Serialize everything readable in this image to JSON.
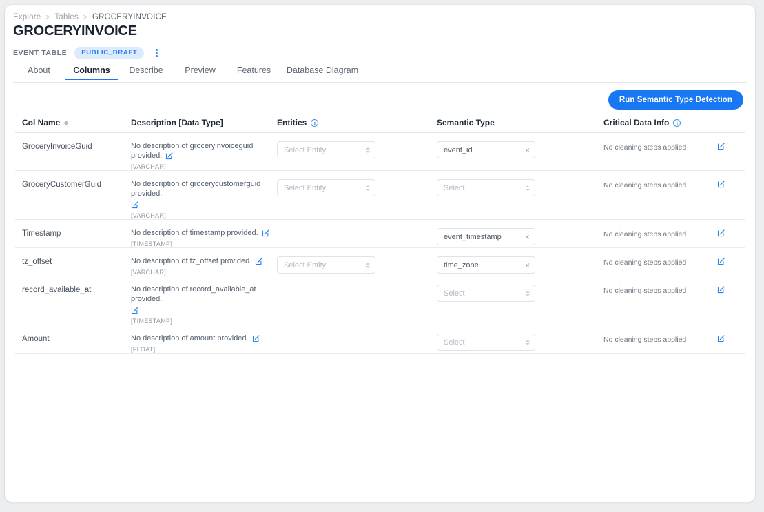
{
  "breadcrumb": {
    "items": [
      "Explore",
      "Tables",
      "GROCERYINVOICE"
    ],
    "separator": ">"
  },
  "header": {
    "title": "GROCERYINVOICE",
    "kind": "EVENT TABLE",
    "badge": "PUBLIC_DRAFT",
    "kebab_icon": "more-vertical-icon"
  },
  "tabs": [
    {
      "label": "About",
      "active": false,
      "width": 75
    },
    {
      "label": "Columns",
      "active": true,
      "width": 78
    },
    {
      "label": "Describe",
      "active": false,
      "width": 80
    },
    {
      "label": "Preview",
      "active": false,
      "width": 77
    },
    {
      "label": "Features",
      "active": false,
      "width": 79
    },
    {
      "label": "Database Diagram",
      "active": false,
      "width": 120
    }
  ],
  "toolbar": {
    "run_detection_label": "Run Semantic Type Detection",
    "accent_color": "#1877f2"
  },
  "table": {
    "headers": {
      "col_name": "Col Name",
      "description": "Description [Data Type]",
      "entities": "Entities",
      "semantic_type": "Semantic Type",
      "critical_data_info": "Critical Data Info"
    },
    "rows": [
      {
        "col_name": "GroceryInvoiceGuid",
        "description": "No description of groceryinvoiceguid provided.",
        "data_type": "[VARCHAR]",
        "desc_icon_block": false,
        "entity": {
          "value": "",
          "placeholder": "Select Entity",
          "has_control": true,
          "clearable": false
        },
        "semantic": {
          "value": "event_id",
          "placeholder": "Select",
          "has_control": true,
          "clearable": true
        },
        "critical_data_info": "No cleaning steps applied",
        "height": 41
      },
      {
        "col_name": "GroceryCustomerGuid",
        "description": "No description of grocerycustomerguid provided.",
        "data_type": "[VARCHAR]",
        "desc_icon_block": true,
        "entity": {
          "value": "",
          "placeholder": "Select Entity",
          "has_control": true,
          "clearable": false
        },
        "semantic": {
          "value": "",
          "placeholder": "Select",
          "has_control": true,
          "clearable": false
        },
        "critical_data_info": "No cleaning steps applied",
        "height": 55
      },
      {
        "col_name": "Timestamp",
        "description": "No description of timestamp provided.",
        "data_type": "[TIMESTAMP]",
        "desc_icon_block": false,
        "entity": {
          "value": "",
          "placeholder": "Select Entity",
          "has_control": false,
          "clearable": false
        },
        "semantic": {
          "value": "event_timestamp",
          "placeholder": "Select",
          "has_control": true,
          "clearable": true
        },
        "critical_data_info": "No cleaning steps applied",
        "height": 41
      },
      {
        "col_name": "tz_offset",
        "description": "No description of tz_offset provided.",
        "data_type": "[VARCHAR]",
        "desc_icon_block": false,
        "entity": {
          "value": "",
          "placeholder": "Select Entity",
          "has_control": true,
          "clearable": false
        },
        "semantic": {
          "value": "time_zone",
          "placeholder": "Select",
          "has_control": true,
          "clearable": true
        },
        "critical_data_info": "No cleaning steps applied",
        "height": 41
      },
      {
        "col_name": "record_available_at",
        "description": "No description of record_available_at provided.",
        "data_type": "[TIMESTAMP]",
        "desc_icon_block": true,
        "entity": {
          "value": "",
          "placeholder": "Select Entity",
          "has_control": false,
          "clearable": false
        },
        "semantic": {
          "value": "",
          "placeholder": "Select",
          "has_control": true,
          "clearable": false
        },
        "critical_data_info": "No cleaning steps applied",
        "height": 55
      },
      {
        "col_name": "Amount",
        "description": "No description of amount provided.",
        "data_type": "[FLOAT]",
        "desc_icon_block": false,
        "entity": {
          "value": "",
          "placeholder": "Select Entity",
          "has_control": false,
          "clearable": false
        },
        "semantic": {
          "value": "",
          "placeholder": "Select",
          "has_control": true,
          "clearable": false
        },
        "critical_data_info": "No cleaning steps applied",
        "height": 41
      }
    ]
  }
}
